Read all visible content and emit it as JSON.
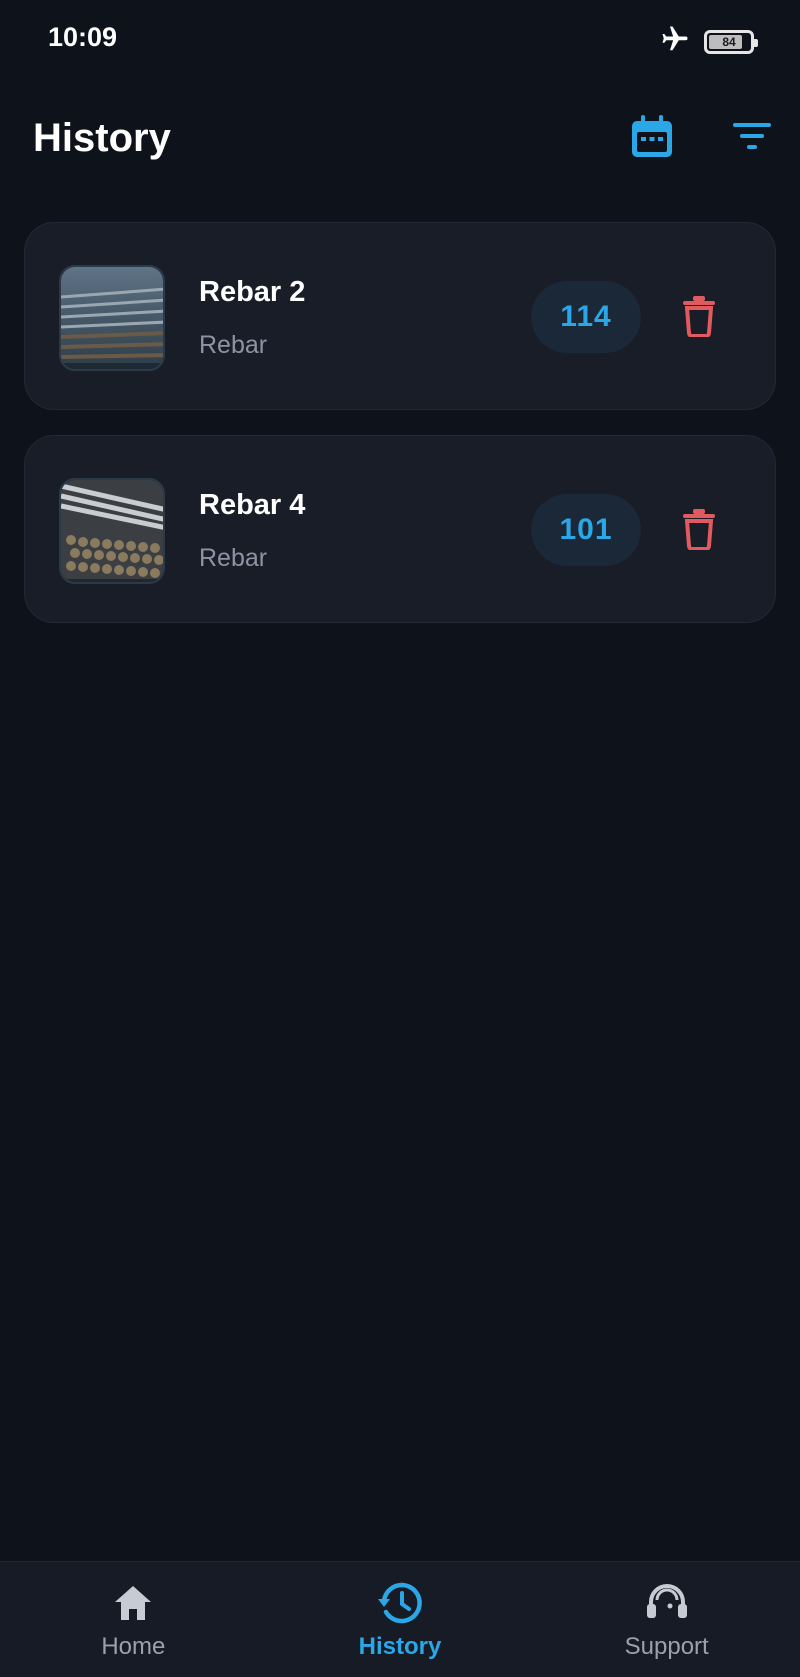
{
  "status_bar": {
    "time": "10:09",
    "battery_level": 84,
    "icons": [
      "airplane-icon",
      "battery-icon"
    ]
  },
  "header": {
    "title": "History",
    "actions": [
      {
        "icon": "calendar-icon"
      },
      {
        "icon": "filter-icon"
      }
    ]
  },
  "history": {
    "items": [
      {
        "title": "Rebar 2",
        "subtitle": "Rebar",
        "count": "114",
        "thumbnail": "rebar-photo"
      },
      {
        "title": "Rebar 4",
        "subtitle": "Rebar",
        "count": "101",
        "thumbnail": "rebar-photo"
      }
    ]
  },
  "nav": {
    "items": [
      {
        "label": "Home",
        "icon": "home-icon"
      },
      {
        "label": "History",
        "icon": "history-icon",
        "active": true
      },
      {
        "label": "Support",
        "icon": "headset-icon"
      }
    ]
  },
  "colors": {
    "background": "#0e121a",
    "card": "#181d27",
    "accent": "#2ba6e6",
    "danger": "#e05a5f",
    "muted_text": "#8c94a3"
  }
}
